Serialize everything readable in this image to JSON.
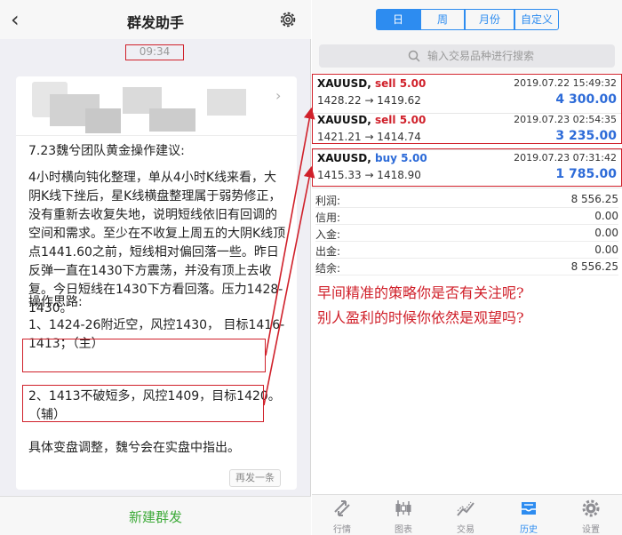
{
  "left": {
    "title": "群发助手",
    "back_icon": "chevron-left-icon",
    "settings_icon": "gear-icon",
    "timestamp": "09:34",
    "message": {
      "heading": "7.23魏兮团队黄金操作建议:",
      "analysis": "4小时横向钝化整理，单从4小时K线来看，大阴K线下挫后，星K线横盘整理属于弱势修正，没有重新去收复失地，说明短线依旧有回调的空间和需求。至少在不收复上周五的大阴K线顶点1441.60之前，短线相对偏回落一些。昨日反弹一直在1430下方震荡，并没有顶上去收复。今日短线在1430下方看回落。压力1428-1430。",
      "ideas_title": "操作思路:",
      "plan1": "1、1424-26附近空，风控1430， 目标1416-1413；（主）",
      "plan2": "2、1413不破短多，风控1409，目标1420。（辅）",
      "footer_note": "具体变盘调整，魏兮会在实盘中指出。",
      "resend_label": "再发一条"
    },
    "new_broadcast_label": "新建群发"
  },
  "right": {
    "segments": [
      "日",
      "周",
      "月份",
      "自定义"
    ],
    "active_segment": 0,
    "search_placeholder": "输入交易品种进行搜索",
    "trades": [
      {
        "symbol": "XAUUSD,",
        "side": "sell 5.00",
        "date": "2019.07.22 15:49:32",
        "prices": "1428.22 → 1419.62",
        "profit": "4 300.00"
      },
      {
        "symbol": "XAUUSD,",
        "side": "sell 5.00",
        "date": "2019.07.23 02:54:35",
        "prices": "1421.21 → 1414.74",
        "profit": "3 235.00"
      },
      {
        "symbol": "XAUUSD,",
        "side": "buy 5.00",
        "date": "2019.07.23 07:31:42",
        "prices": "1415.33 → 1418.90",
        "profit": "1 785.00"
      }
    ],
    "summary": [
      {
        "label": "利润:",
        "value": "8 556.25"
      },
      {
        "label": "信用:",
        "value": "0.00"
      },
      {
        "label": "入金:",
        "value": "0.00"
      },
      {
        "label": "出金:",
        "value": "0.00"
      },
      {
        "label": "结余:",
        "value": "8 556.25"
      }
    ],
    "promo_line1": "早间精准的策略你是否有关注呢?",
    "promo_line2": "别人盈利的时候你依然是观望吗?",
    "tabs": [
      {
        "label": "行情",
        "icon": "quotes-arrows-icon"
      },
      {
        "label": "图表",
        "icon": "candlestick-chart-icon"
      },
      {
        "label": "交易",
        "icon": "trade-chart-icon"
      },
      {
        "label": "历史",
        "icon": "history-inbox-icon"
      },
      {
        "label": "设置",
        "icon": "gear-icon"
      }
    ],
    "active_tab": 3
  },
  "colors": {
    "accent_blue": "#2d8cf0",
    "highlight_red": "#d0202a",
    "wechat_green": "#3daa39",
    "sell_red": "#d0202a",
    "buy_blue": "#2d6bd8"
  }
}
